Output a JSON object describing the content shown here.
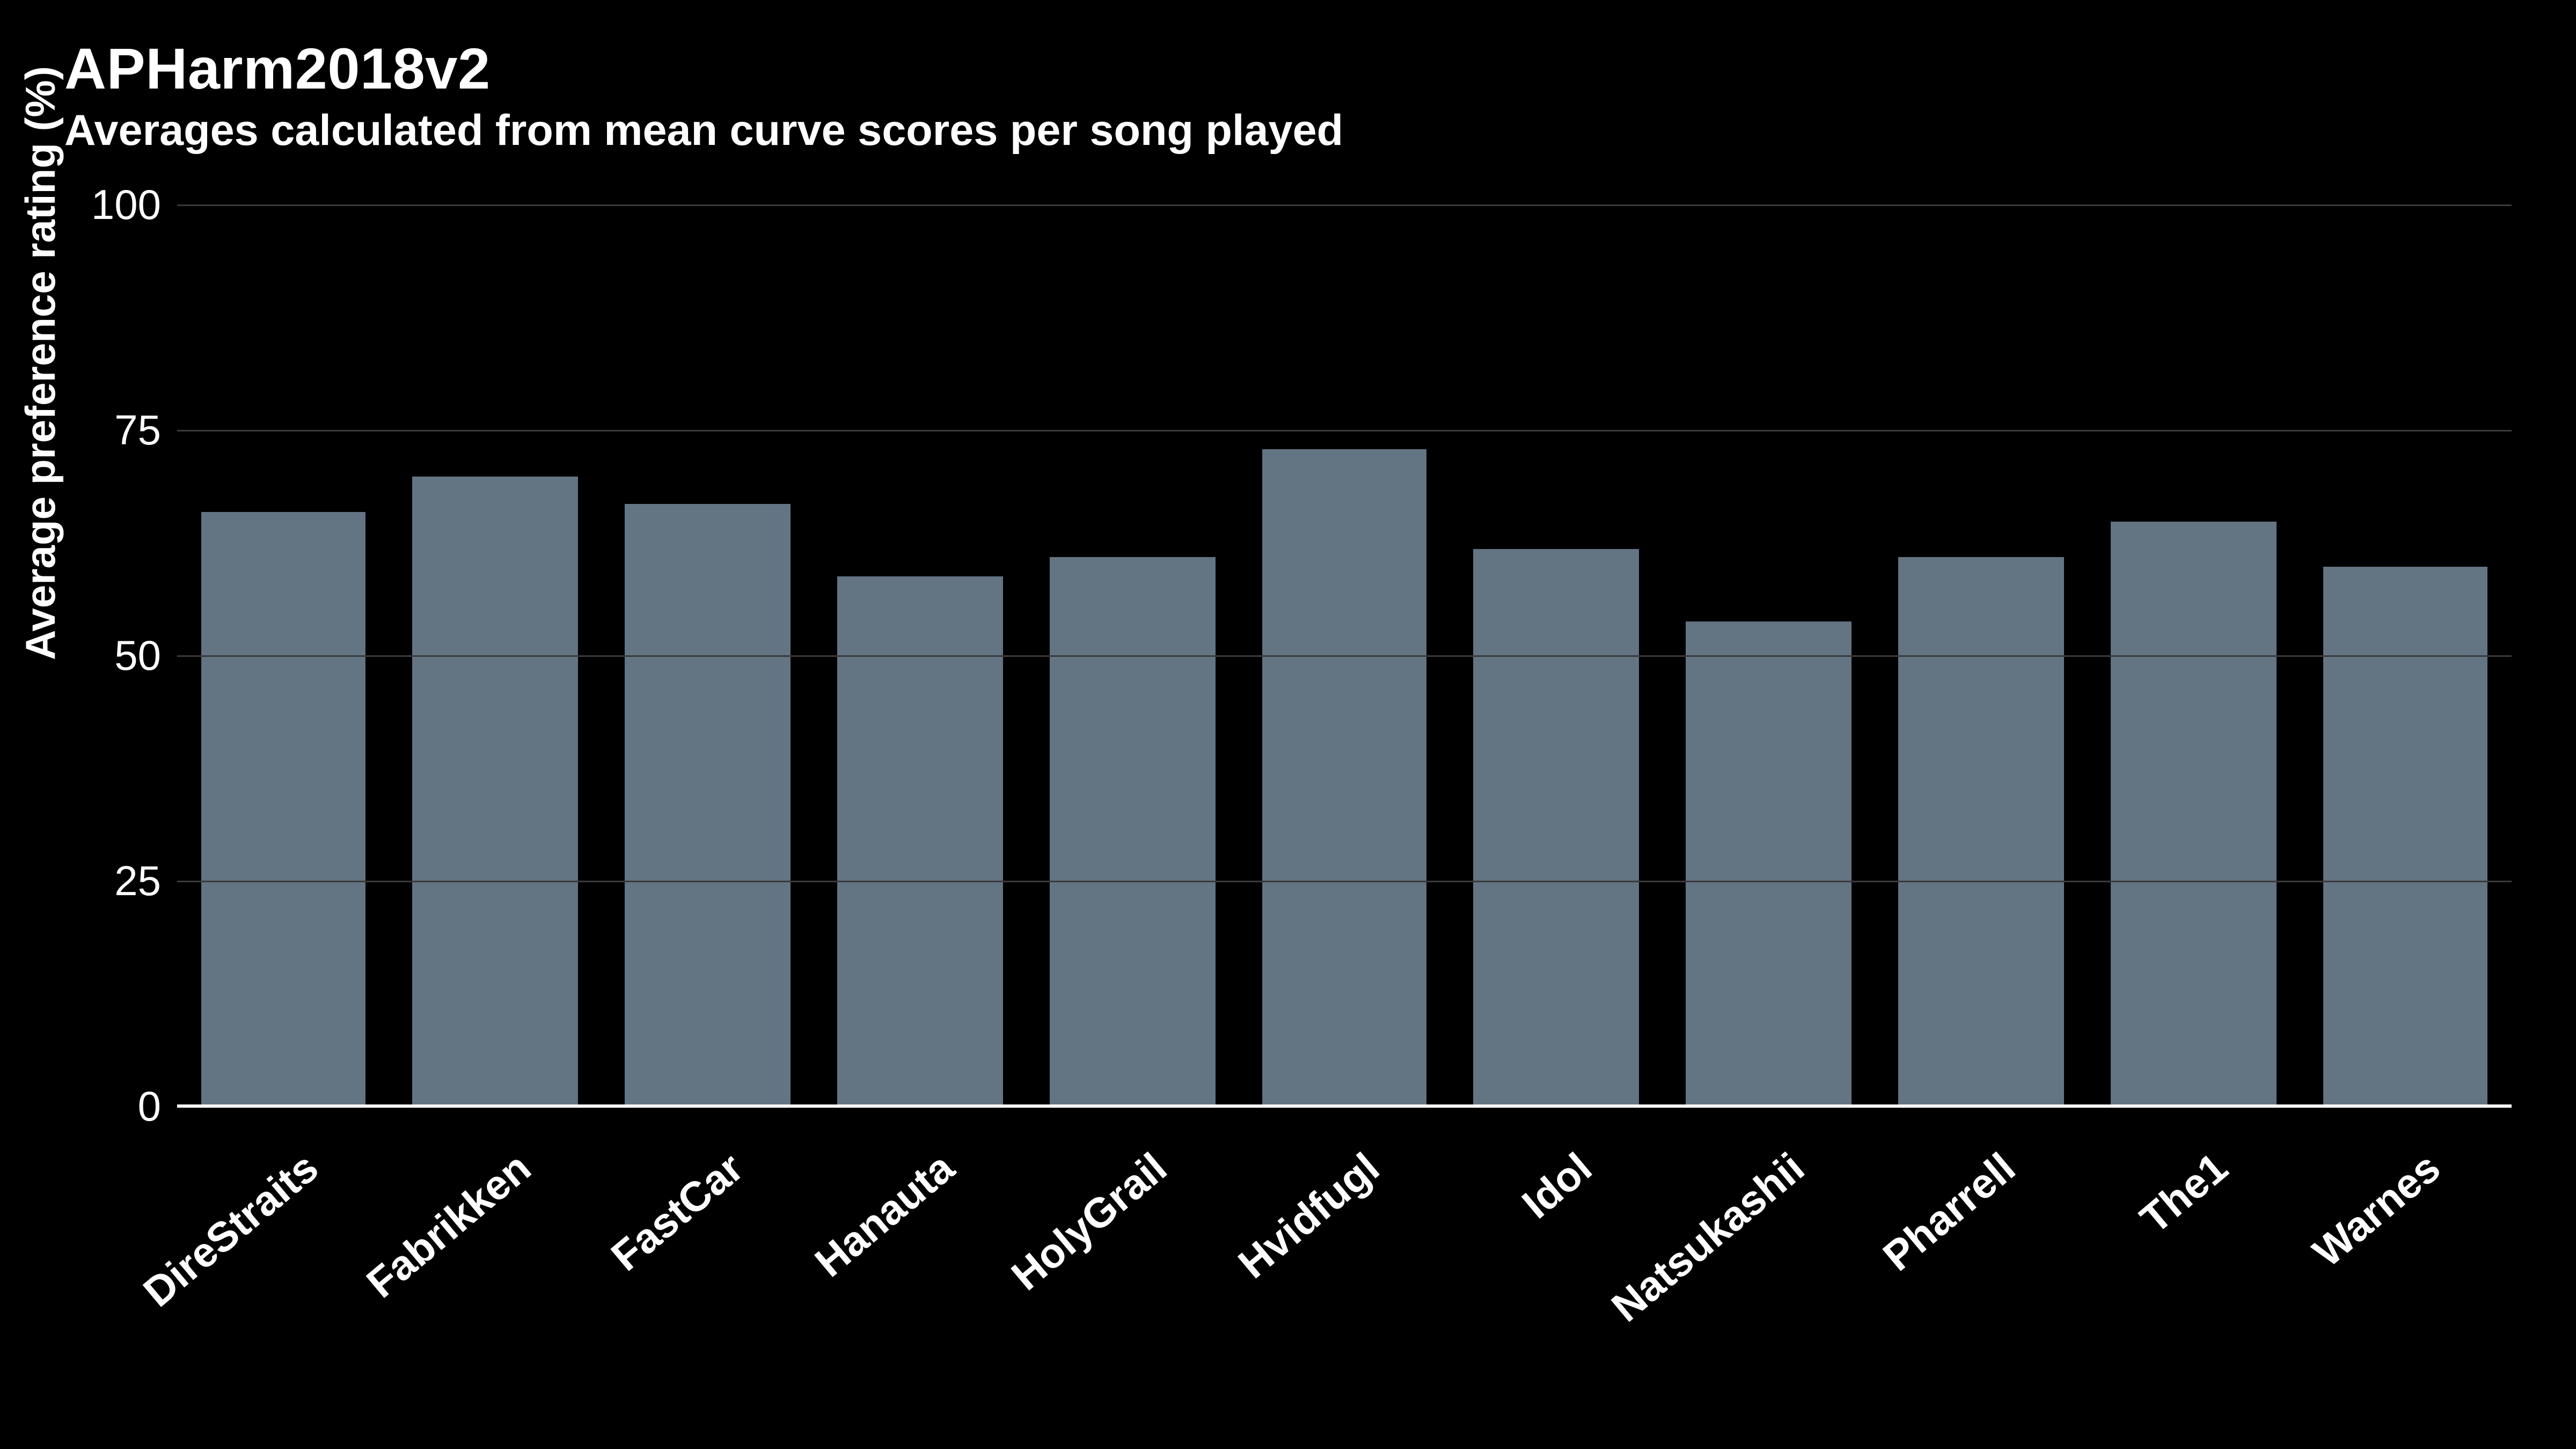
{
  "title": "APHarm2018v2",
  "subtitle": "Averages calculated from mean curve scores per song played",
  "ylabel": "Average preference rating (%)",
  "yticks": [
    0,
    25,
    50,
    75,
    100
  ],
  "chart_data": {
    "type": "bar",
    "title": "APHarm2018v2",
    "xlabel": "",
    "ylabel": "Average preference rating (%)",
    "ylim": [
      0,
      100
    ],
    "categories": [
      "DireStraits",
      "Fabrikken",
      "FastCar",
      "Hanauta",
      "HolyGrail",
      "Hvidfugl",
      "Idol",
      "Natsukashii",
      "Pharrell",
      "The1",
      "Warnes"
    ],
    "values": [
      66,
      70,
      67,
      59,
      61,
      73,
      62,
      54,
      61,
      65,
      60
    ]
  },
  "colors": {
    "bar": "#637483",
    "bg": "#000000",
    "grid": "#3a3a3a",
    "text": "#ffffff"
  }
}
